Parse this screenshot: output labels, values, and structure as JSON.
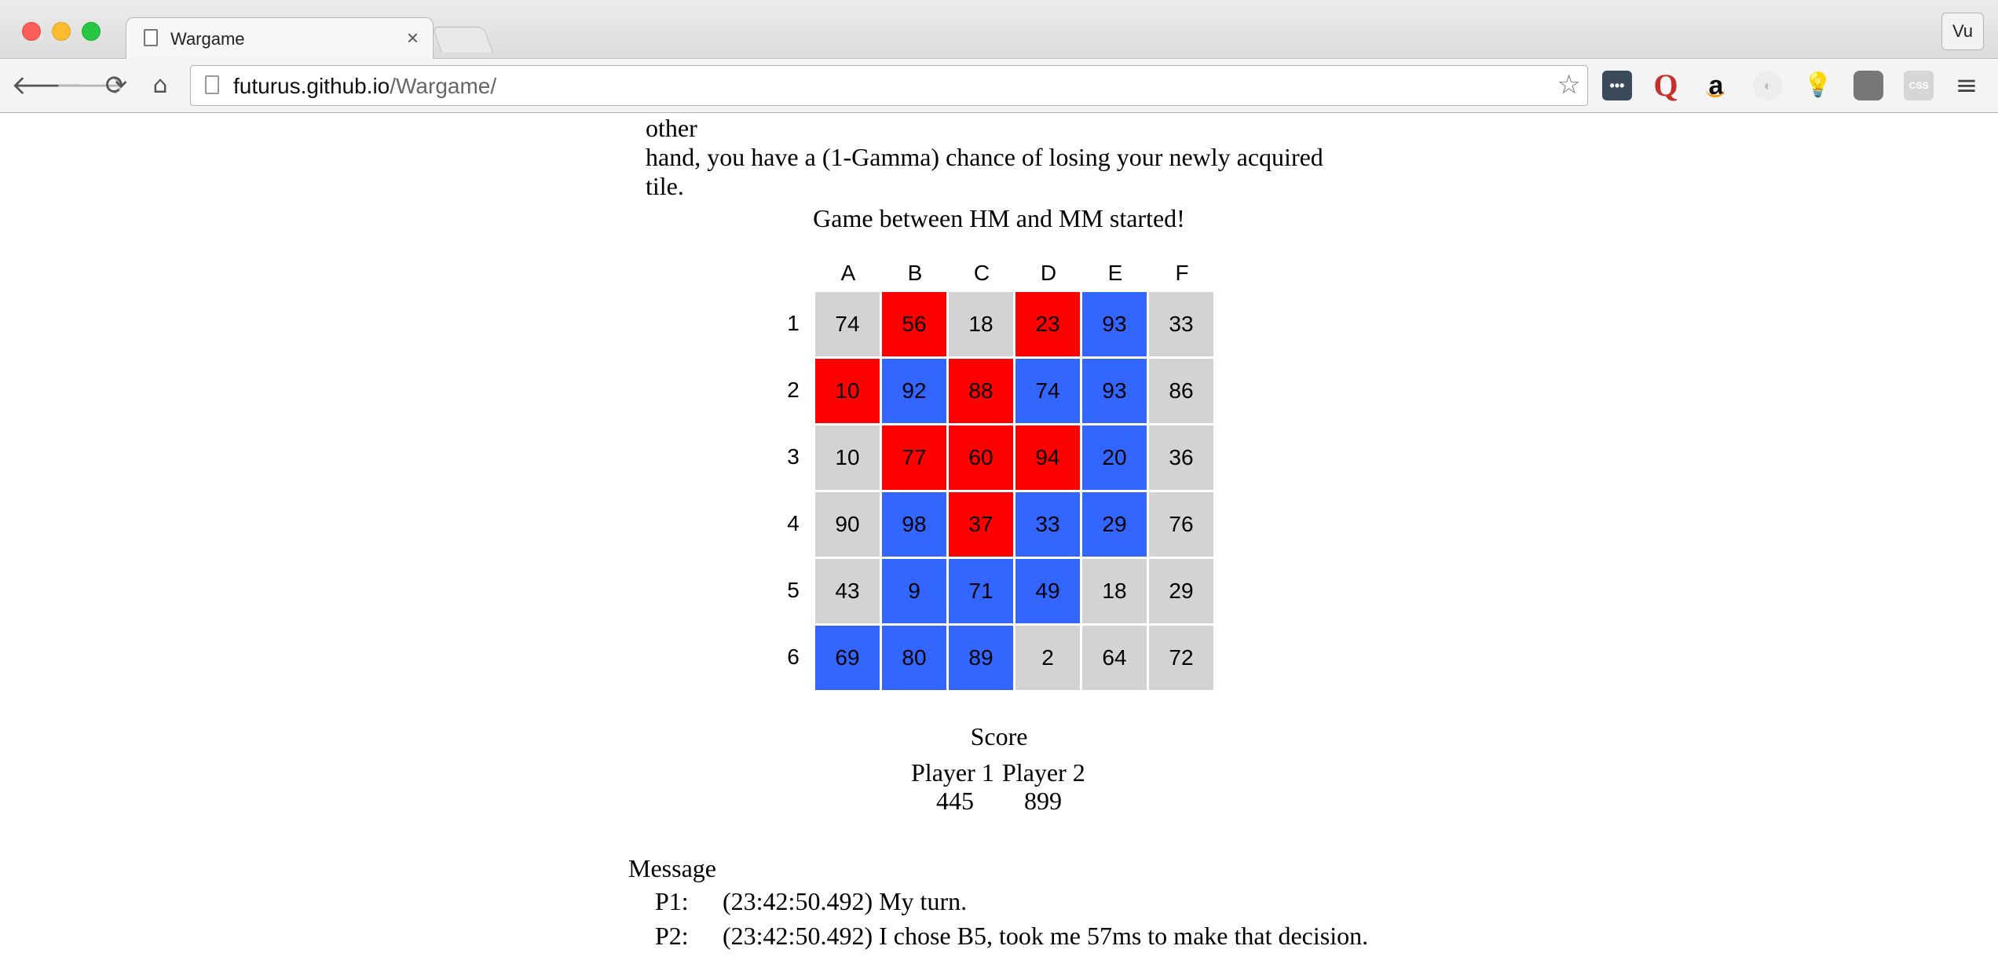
{
  "browser": {
    "tab_title": "Wargame",
    "tab_close": "×",
    "profile": "Vu",
    "url_host": "futurus.github.io",
    "url_path": "/Wargame/",
    "back_glyph": "🡐",
    "forward_glyph": "🡒",
    "reload_glyph": "⟳",
    "home_glyph": "⌂",
    "star_glyph": "☆",
    "menu_glyph": "≡",
    "extensions": [
      {
        "name": "lastpass-icon",
        "glyph": "•••"
      },
      {
        "name": "quora-icon",
        "glyph": "Q"
      },
      {
        "name": "amazon-icon",
        "glyph": "a"
      },
      {
        "name": "privacy-extension-icon",
        "glyph": "◐"
      },
      {
        "name": "lightbulb-icon",
        "glyph": "💡"
      },
      {
        "name": "square-extension-icon",
        "glyph": ""
      },
      {
        "name": "css-icon",
        "glyph": "CSS"
      }
    ]
  },
  "page": {
    "intro_lines": [
      "next to it, you have a Gamma chance of capturing them. On the other",
      "hand, you have a (1-Gamma) chance of losing your newly acquired",
      "tile."
    ],
    "status": "Game between HM and MM started!",
    "columns": [
      "A",
      "B",
      "C",
      "D",
      "E",
      "F"
    ],
    "rows": [
      "1",
      "2",
      "3",
      "4",
      "5",
      "6"
    ],
    "board_values": [
      [
        74,
        56,
        18,
        23,
        93,
        33
      ],
      [
        10,
        92,
        88,
        74,
        93,
        86
      ],
      [
        10,
        77,
        60,
        94,
        20,
        36
      ],
      [
        90,
        98,
        37,
        33,
        29,
        76
      ],
      [
        43,
        9,
        71,
        49,
        18,
        29
      ],
      [
        69,
        80,
        89,
        2,
        64,
        72
      ]
    ],
    "board_owners": [
      [
        "g",
        "r",
        "g",
        "r",
        "b",
        "g"
      ],
      [
        "r",
        "b",
        "r",
        "b",
        "b",
        "g"
      ],
      [
        "g",
        "r",
        "r",
        "r",
        "b",
        "g"
      ],
      [
        "g",
        "b",
        "r",
        "b",
        "b",
        "g"
      ],
      [
        "g",
        "b",
        "b",
        "b",
        "g",
        "g"
      ],
      [
        "b",
        "b",
        "b",
        "g",
        "g",
        "g"
      ]
    ],
    "colors": {
      "neutral": "#d3d3d3",
      "red": "#ff0000",
      "blue": "#3366ff"
    },
    "score": {
      "title": "Score",
      "player1_label": "Player 1",
      "player2_label": "Player 2",
      "player1_value": "445",
      "player2_value": "899"
    },
    "messages": {
      "title": "Message",
      "entries": [
        {
          "who": "P1:",
          "text": "(23:42:50.492) My turn."
        },
        {
          "who": "P2:",
          "text": "(23:42:50.492) I chose B5, took me 57ms to make that decision."
        }
      ]
    }
  }
}
